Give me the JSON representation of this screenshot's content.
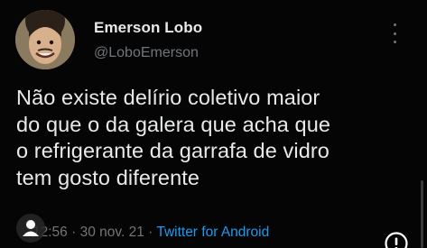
{
  "author": {
    "name": "Emerson Lobo",
    "handle": "@LoboEmerson"
  },
  "tweet": {
    "text": "Não existe delírio coletivo maior\ndo que o da galera que acha que\no refrigerante da garrafa de vidro\ntem gosto diferente",
    "time": "12:56",
    "date": "30 nov. 21",
    "source": "Twitter for Android",
    "separator": " · "
  },
  "icons": {
    "more": "more-vertical-icon",
    "person": "person-icon",
    "alert": "alert-icon"
  },
  "colors": {
    "background": "#050505",
    "text": "#e7e9ea",
    "secondary": "#71767b",
    "accent": "#1d9bf0"
  }
}
